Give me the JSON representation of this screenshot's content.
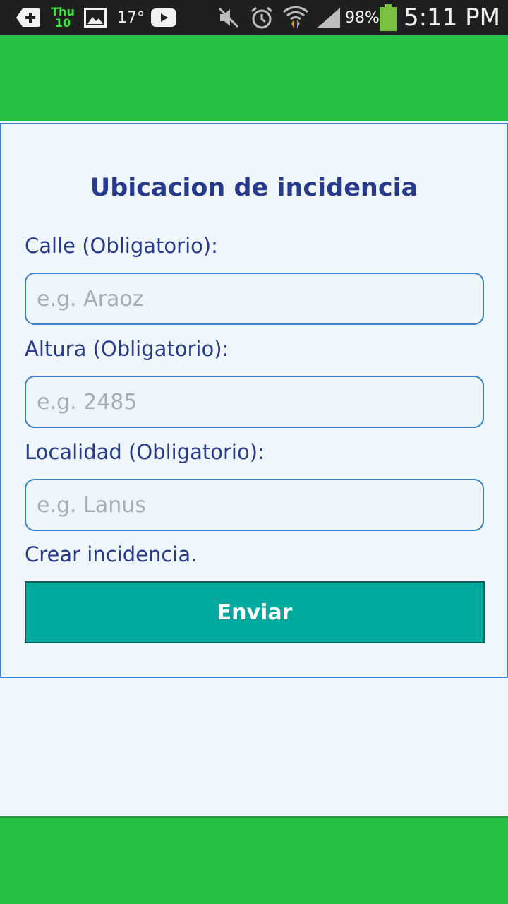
{
  "status_bar": {
    "day": "Thu",
    "date": "10",
    "temperature": "17°",
    "battery": "98%",
    "time": "5:11 PM"
  },
  "form": {
    "title": "Ubicacion de incidencia",
    "fields": [
      {
        "label": "Calle (Obligatorio):",
        "placeholder": "e.g. Araoz",
        "value": ""
      },
      {
        "label": "Altura (Obligatorio):",
        "placeholder": "e.g. 2485",
        "value": ""
      },
      {
        "label": "Localidad (Obligatorio):",
        "placeholder": "e.g. Lanus",
        "value": ""
      }
    ],
    "caption": "Crear incidencia.",
    "submit_label": "Enviar"
  },
  "colors": {
    "header": "#27c047",
    "accent_text": "#283a8c",
    "button": "#00a99d",
    "input_border": "#3b82c9"
  }
}
